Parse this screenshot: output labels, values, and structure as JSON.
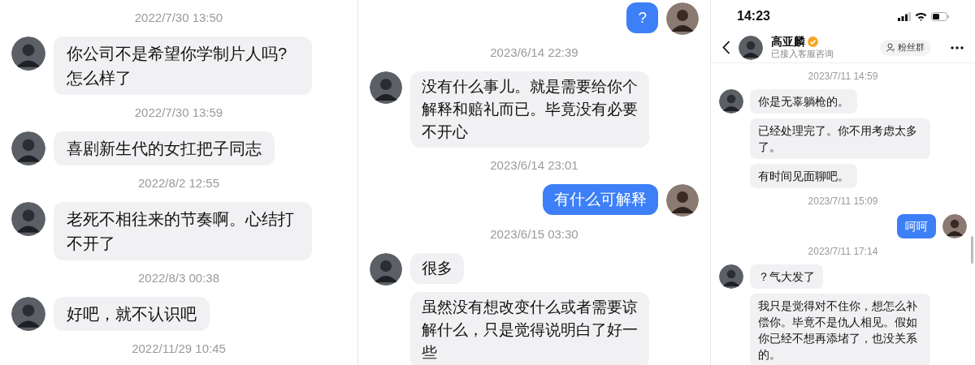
{
  "panels": [
    {
      "kind": "chat",
      "items": [
        {
          "kind": "time",
          "text": "2022/7/30 13:50"
        },
        {
          "kind": "incoming",
          "avatar": true,
          "text": "你公司不是希望你学制片人吗?怎么样了"
        },
        {
          "kind": "time",
          "text": "2022/7/30 13:59"
        },
        {
          "kind": "incoming",
          "avatar": true,
          "text": "喜剧新生代的女扛把子同志"
        },
        {
          "kind": "time",
          "text": "2022/8/2 12:55"
        },
        {
          "kind": "incoming",
          "avatar": true,
          "text": "老死不相往来的节奏啊。心结打不开了"
        },
        {
          "kind": "time",
          "text": "2022/8/3 00:38"
        },
        {
          "kind": "incoming",
          "avatar": true,
          "text": "好吧，就不认识吧"
        },
        {
          "kind": "time",
          "text": "2022/11/29 10:45"
        }
      ]
    },
    {
      "kind": "chat",
      "items": [
        {
          "kind": "outgoing",
          "avatar": true,
          "text": "?"
        },
        {
          "kind": "time",
          "text": "2023/6/14 22:39"
        },
        {
          "kind": "incoming",
          "avatar": true,
          "text": "没有什么事儿。就是需要给你个解释和赔礼而已。毕竟没有必要不开心"
        },
        {
          "kind": "time",
          "text": "2023/6/14 23:01"
        },
        {
          "kind": "outgoing",
          "avatar": true,
          "text": "有什么可解释"
        },
        {
          "kind": "time",
          "text": "2023/6/15 03:30"
        },
        {
          "kind": "incoming",
          "avatar": true,
          "text": "很多"
        },
        {
          "kind": "incoming",
          "avatar": false,
          "text": "虽然没有想改变什么或者需要谅解什么，只是觉得说明白了好一些"
        }
      ]
    },
    {
      "kind": "phone",
      "status_bar": {
        "time": "14:23"
      },
      "header": {
        "name": "高亚麟",
        "verified": true,
        "subtitle": "已接入客服咨询",
        "button": "粉丝群"
      },
      "items": [
        {
          "kind": "time",
          "text": "2023/7/11 14:59"
        },
        {
          "kind": "incoming",
          "avatar": true,
          "text": "你是无辜躺枪的。"
        },
        {
          "kind": "incoming",
          "avatar": false,
          "text": "已经处理完了。你不用考虑太多了。"
        },
        {
          "kind": "incoming",
          "avatar": false,
          "text": "有时间见面聊吧。"
        },
        {
          "kind": "time",
          "text": "2023/7/11 15:09"
        },
        {
          "kind": "outgoing",
          "avatar": true,
          "text": "呵呵"
        },
        {
          "kind": "time",
          "text": "2023/7/11 17:14"
        },
        {
          "kind": "incoming",
          "avatar": true,
          "text": "？气大发了"
        },
        {
          "kind": "incoming",
          "avatar": false,
          "text": "我只是觉得对不住你，想怎么补偿你。毕竟不是仇人相见。假如你已经不想再添堵了，也没关系的。"
        }
      ]
    }
  ]
}
